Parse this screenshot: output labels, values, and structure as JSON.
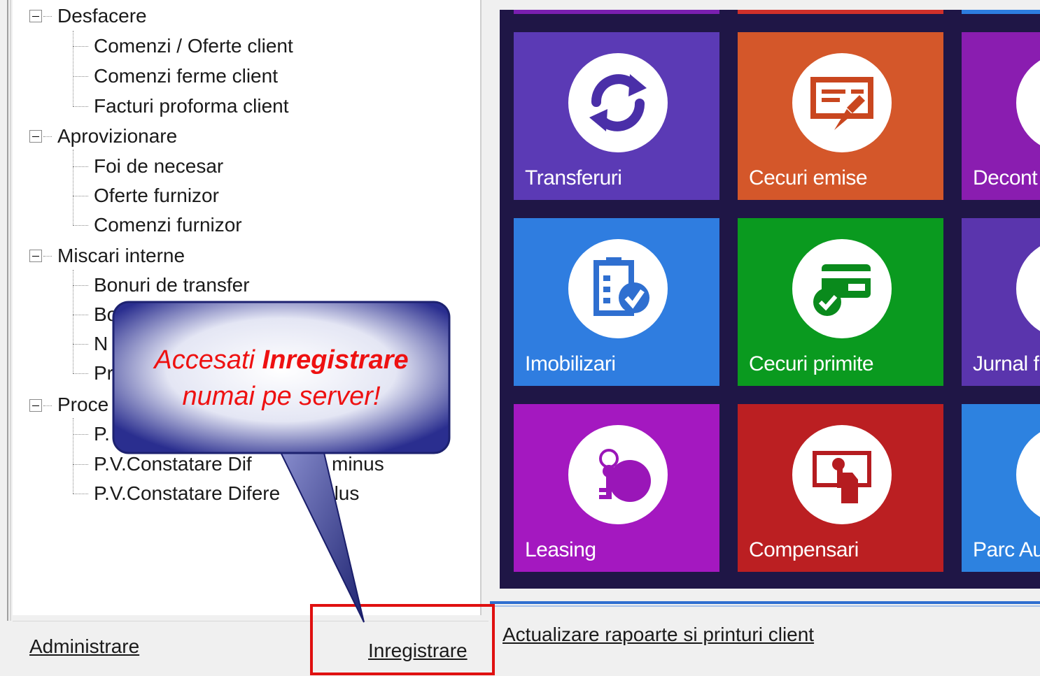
{
  "tree": {
    "items": [
      {
        "label": "Desfacere",
        "level": 0
      },
      {
        "label": "Comenzi / Oferte client",
        "level": 1
      },
      {
        "label": "Comenzi ferme client",
        "level": 1
      },
      {
        "label": "Facturi proforma client",
        "level": 1
      },
      {
        "label": "Aprovizionare",
        "level": 0
      },
      {
        "label": "Foi de necesar",
        "level": 1
      },
      {
        "label": "Oferte furnizor",
        "level": 1
      },
      {
        "label": "Comenzi furnizor",
        "level": 1
      },
      {
        "label": "Miscari interne",
        "level": 0
      },
      {
        "label": "Bonuri de transfer",
        "level": 1
      },
      {
        "label": "Bo",
        "level": 1
      },
      {
        "label": "N",
        "level": 1
      },
      {
        "label": "Pr",
        "level": 1
      },
      {
        "label": "Proce",
        "level": 0
      },
      {
        "label": "P.",
        "level": 1
      },
      {
        "label": "P.V.Constatare Dif",
        "suffix": "minus",
        "level": 1
      },
      {
        "label": "P.V.Constatare Difere",
        "suffix": "plus",
        "level": 1
      }
    ]
  },
  "bottom": {
    "administrare": "Administrare",
    "inregistrare": "Inregistrare",
    "actualizare": "Actualizare rapoarte si printuri client"
  },
  "callout": {
    "line1_pre": "Accesati ",
    "line1_bold": "Inregistrare",
    "line2": "numai pe server!"
  },
  "tiles": [
    {
      "label": "Transferuri",
      "color": "#5b3ab5",
      "icon": "refresh-icon"
    },
    {
      "label": "Cecuri emise",
      "color": "#d4572a",
      "icon": "check-write-icon"
    },
    {
      "label": "Decont",
      "color": "#8a1db0",
      "icon": "partial-icon"
    },
    {
      "label": "Imobilizari",
      "color": "#2f7de0",
      "icon": "clipboard-check-icon"
    },
    {
      "label": "Cecuri primite",
      "color": "#0a9a1f",
      "icon": "card-check-icon"
    },
    {
      "label": "Jurnal f",
      "color": "#5a35ad",
      "icon": "partial-icon"
    },
    {
      "label": "Leasing",
      "color": "#a418c0",
      "icon": "keys-icon"
    },
    {
      "label": "Compensari",
      "color": "#bb1f22",
      "icon": "hand-card-icon"
    },
    {
      "label": "Parc Au",
      "color": "#2d82e0",
      "icon": "partial-icon"
    }
  ],
  "top_strip_colors": [
    "#7a1fb0",
    "#d0302a",
    "#2d7de0"
  ],
  "colors": {
    "highlight": "#e01010",
    "callout_text": "#ee1111",
    "callout_fill": "#2a2e8f"
  }
}
